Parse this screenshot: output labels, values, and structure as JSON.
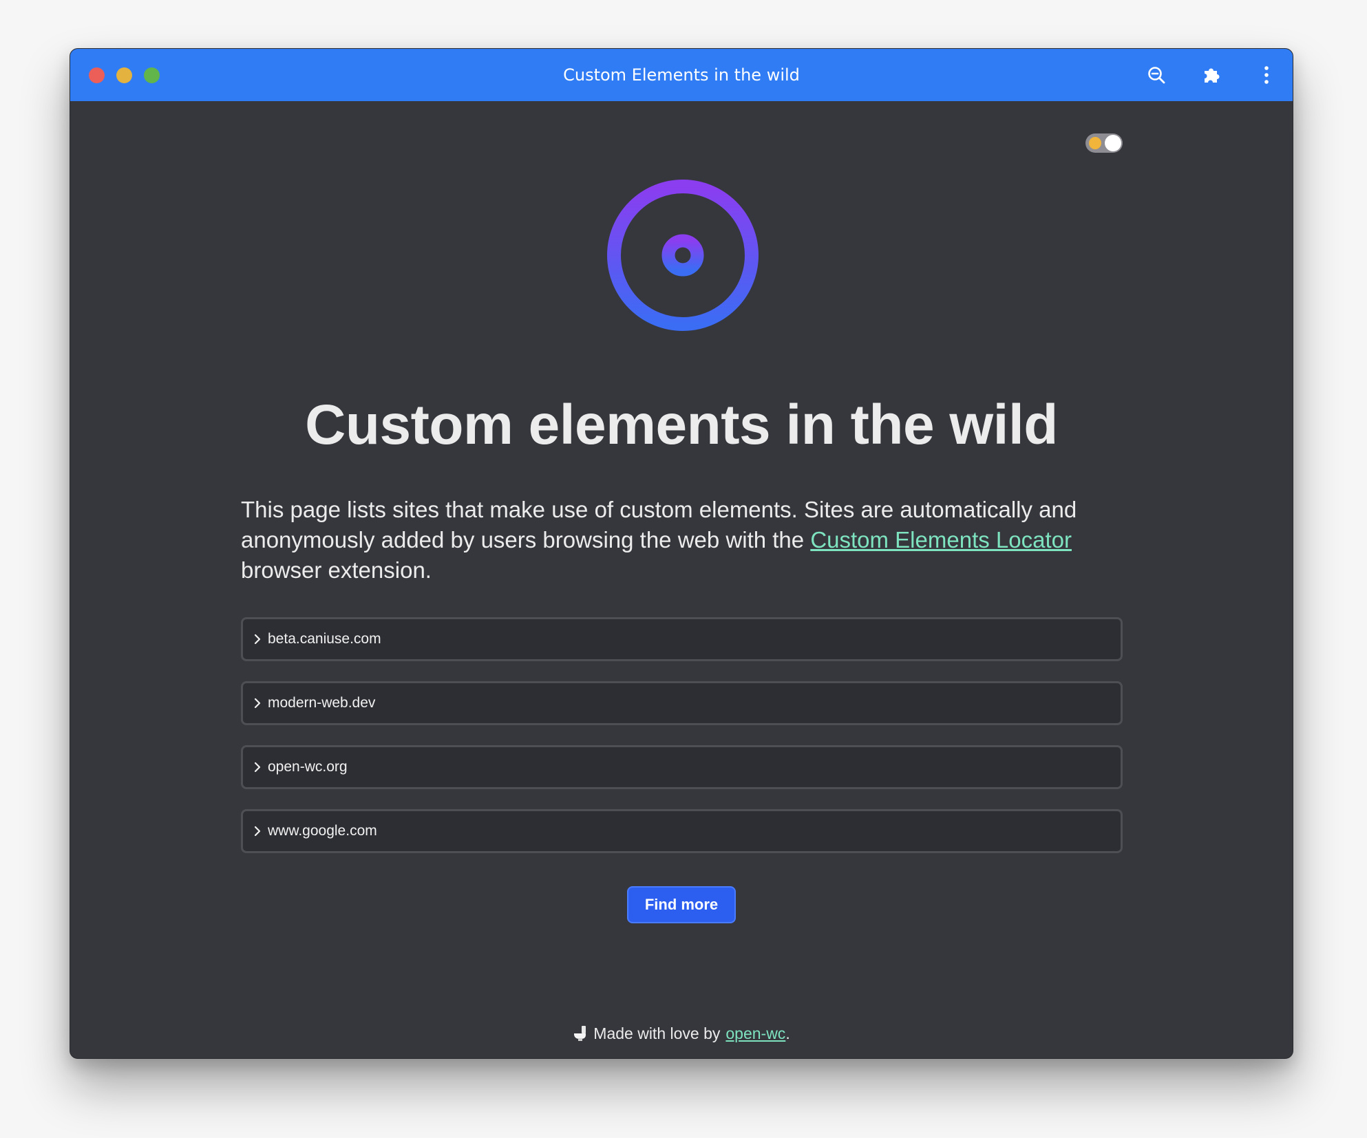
{
  "window": {
    "title": "Custom Elements in the wild"
  },
  "toolbar": {
    "icons": [
      "zoom-out-icon",
      "puzzle-piece-icon",
      "kebab-menu-icon"
    ]
  },
  "theme_toggle": {
    "state": "dark",
    "icon": "sun-icon"
  },
  "main": {
    "heading": "Custom elements in the wild",
    "intro_before": "This page lists sites that make use of custom elements. Sites are automatically and anonymously added by users browsing the web with the ",
    "intro_link": "Custom Elements Locator",
    "intro_after": " browser extension.",
    "sites": [
      {
        "label": "beta.caniuse.com"
      },
      {
        "label": "modern-web.dev"
      },
      {
        "label": "open-wc.org"
      },
      {
        "label": "www.google.com"
      }
    ],
    "find_more_label": "Find more"
  },
  "footer": {
    "text": "Made with love by",
    "link": "open-wc",
    "suffix": "."
  },
  "colors": {
    "titlebar": "#2f7cf4",
    "page_background": "#36373d",
    "link": "#7ee3bf",
    "button": "#2c5ff0",
    "logo_gradient_top": "#8b3df0",
    "logo_gradient_bottom": "#3b6cf4"
  }
}
